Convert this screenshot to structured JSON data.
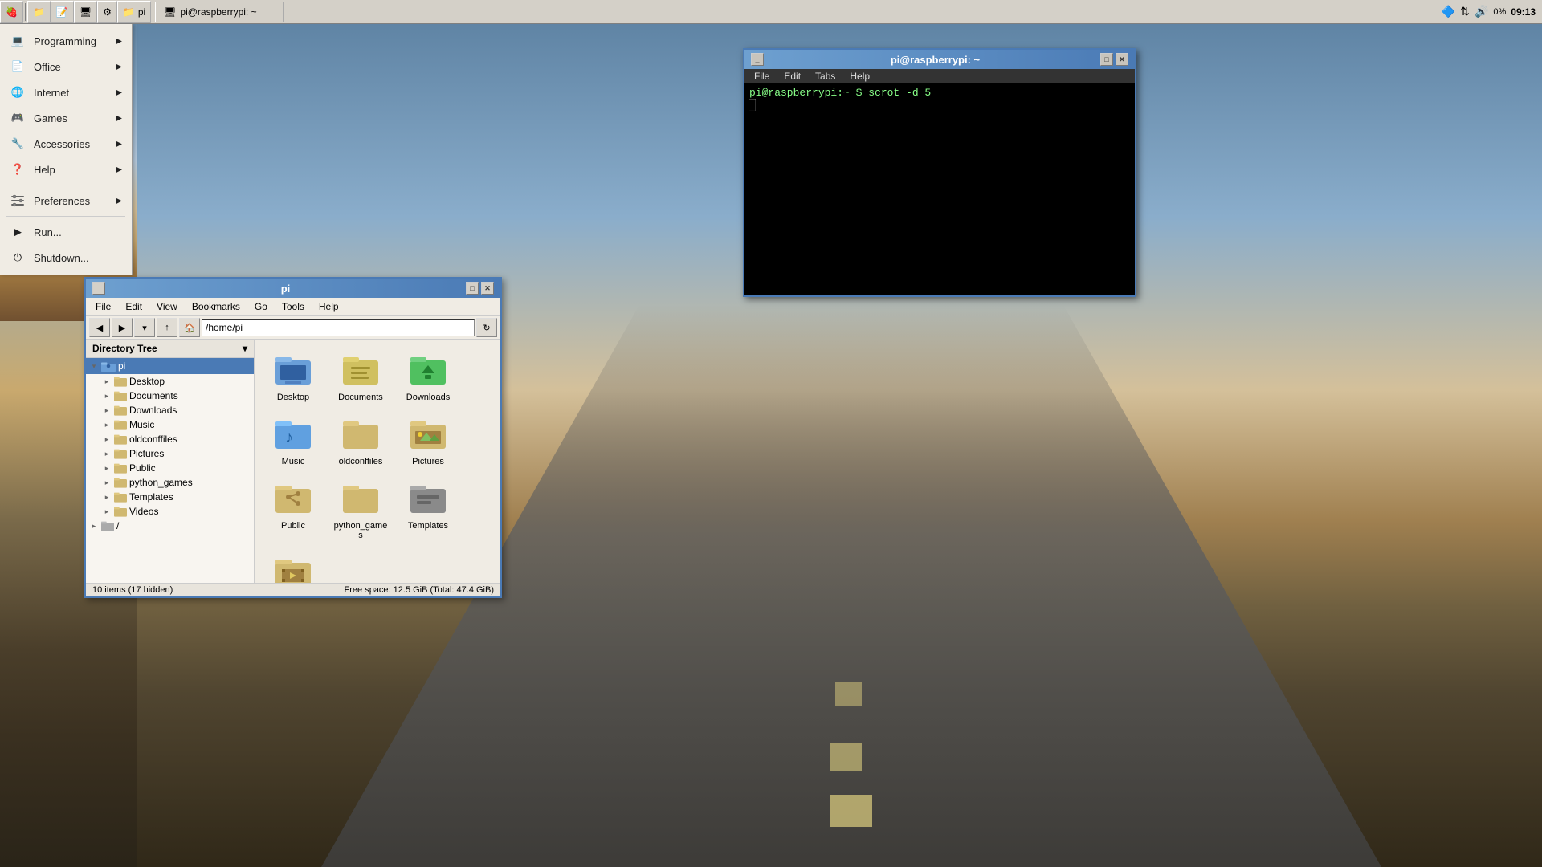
{
  "taskbar": {
    "buttons": [
      {
        "id": "menu-btn",
        "icon": "🍓",
        "label": ""
      },
      {
        "id": "folder-btn",
        "icon": "📁",
        "label": ""
      },
      {
        "id": "terminal-btn",
        "icon": "🖥",
        "label": ""
      },
      {
        "id": "task1-btn",
        "icon": "📁",
        "label": "pi"
      },
      {
        "id": "task2-btn",
        "icon": "🖥",
        "label": "pi@raspberrypi: ~"
      }
    ],
    "time": "09:13",
    "volume": "🔊"
  },
  "appmenu": {
    "items": [
      {
        "id": "programming",
        "label": "Programming",
        "icon": "💻",
        "arrow": true
      },
      {
        "id": "office",
        "label": "Office",
        "icon": "📄",
        "arrow": true
      },
      {
        "id": "internet",
        "label": "Internet",
        "icon": "🌐",
        "arrow": true
      },
      {
        "id": "games",
        "label": "Games",
        "icon": "🎮",
        "arrow": true
      },
      {
        "id": "accessories",
        "label": "Accessories",
        "icon": "🔧",
        "arrow": true
      },
      {
        "id": "help",
        "label": "Help",
        "icon": "❓",
        "arrow": true
      },
      {
        "id": "preferences",
        "label": "Preferences",
        "icon": "⚙",
        "arrow": true
      },
      {
        "id": "run",
        "label": "Run...",
        "icon": "▶",
        "arrow": false
      },
      {
        "id": "shutdown",
        "label": "Shutdown...",
        "icon": "⏻",
        "arrow": false
      }
    ]
  },
  "filemanager": {
    "title": "pi",
    "address": "/home/pi",
    "menubar": [
      "File",
      "Edit",
      "View",
      "Bookmarks",
      "Go",
      "Tools",
      "Help"
    ],
    "sidebar_header": "Directory Tree",
    "tree_items": [
      {
        "id": "pi",
        "label": "pi",
        "level": 0,
        "selected": true,
        "expanded": true,
        "root": true
      },
      {
        "id": "desktop",
        "label": "Desktop",
        "level": 1
      },
      {
        "id": "documents",
        "label": "Documents",
        "level": 1
      },
      {
        "id": "downloads",
        "label": "Downloads",
        "level": 1
      },
      {
        "id": "music",
        "label": "Music",
        "level": 1
      },
      {
        "id": "oldconffiles",
        "label": "oldconffiles",
        "level": 1
      },
      {
        "id": "pictures",
        "label": "Pictures",
        "level": 1
      },
      {
        "id": "public",
        "label": "Public",
        "level": 1
      },
      {
        "id": "python_games",
        "label": "python_games",
        "level": 1
      },
      {
        "id": "templates",
        "label": "Templates",
        "level": 1
      },
      {
        "id": "videos",
        "label": "Videos",
        "level": 1
      },
      {
        "id": "root",
        "label": "/",
        "level": 0,
        "root": true
      }
    ],
    "files": [
      {
        "id": "desktop-folder",
        "label": "Desktop",
        "icon": "desktop"
      },
      {
        "id": "documents-folder",
        "label": "Documents",
        "icon": "documents"
      },
      {
        "id": "downloads-folder",
        "label": "Downloads",
        "icon": "downloads"
      },
      {
        "id": "music-folder",
        "label": "Music",
        "icon": "music"
      },
      {
        "id": "oldconffiles-folder",
        "label": "oldconffiles",
        "icon": "folder"
      },
      {
        "id": "pictures-folder",
        "label": "Pictures",
        "icon": "pictures"
      },
      {
        "id": "public-folder",
        "label": "Public",
        "icon": "public"
      },
      {
        "id": "python_games-folder",
        "label": "python_games",
        "icon": "folder"
      },
      {
        "id": "templates-folder",
        "label": "Templates",
        "icon": "templates"
      },
      {
        "id": "videos-folder",
        "label": "Videos",
        "icon": "videos"
      }
    ],
    "statusbar_left": "10 items (17 hidden)",
    "statusbar_right": "Free space: 12.5 GiB (Total: 47.4 GiB)"
  },
  "terminal": {
    "title": "pi@raspberrypi: ~",
    "menubar": [
      "File",
      "Edit",
      "Tabs",
      "Help"
    ],
    "prompt": "pi@raspberrypi:~ $ scrot -d 5",
    "cursor": "█"
  }
}
